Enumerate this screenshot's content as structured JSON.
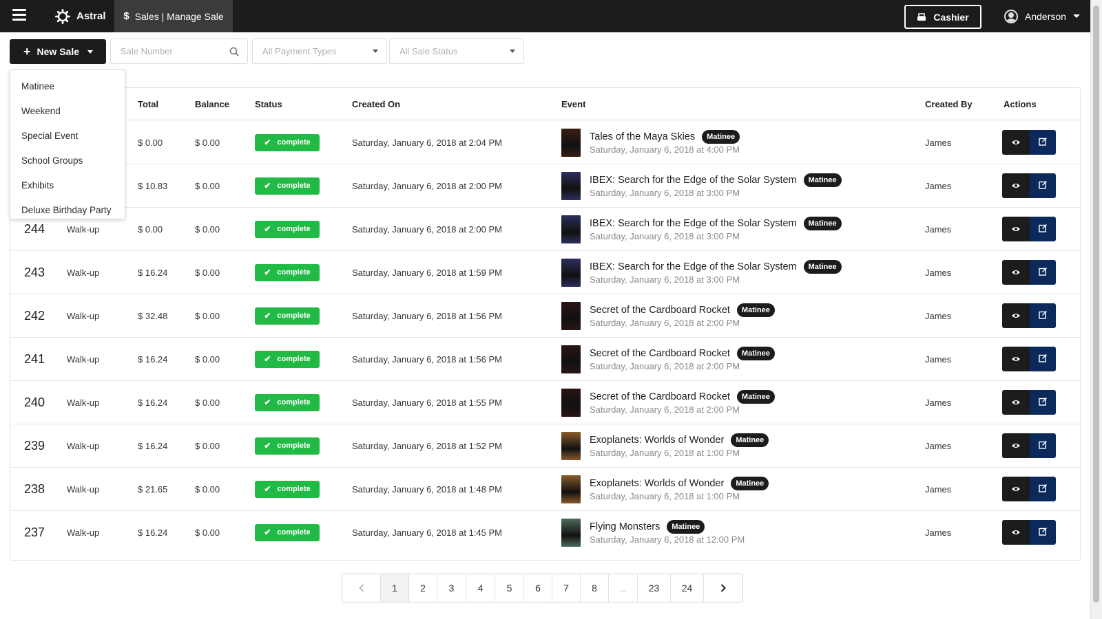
{
  "header": {
    "brand": "Astral",
    "nav_active": "Sales | Manage Sale",
    "cashier_label": "Cashier",
    "user_name": "Anderson"
  },
  "toolbar": {
    "new_sale_label": "New Sale",
    "search_placeholder": "Sale Number",
    "payment_types_label": "All Payment Types",
    "sale_status_label": "All Sale Status"
  },
  "new_sale_menu": [
    "Matinee",
    "Weekend",
    "Special Event",
    "School Groups",
    "Exhibits",
    "Deluxe Birthday Party"
  ],
  "table": {
    "headers": {
      "total": "Total",
      "balance": "Balance",
      "status": "Status",
      "created_on": "Created On",
      "event": "Event",
      "created_by": "Created By",
      "actions": "Actions"
    },
    "rows": [
      {
        "num": "",
        "type": "",
        "total": "$ 0.00",
        "balance": "$ 0.00",
        "status": "complete",
        "created_on": "Saturday, January 6, 2018 at 2:04 PM",
        "event_title": "Tales of the Maya Skies",
        "event_tag": "Matinee",
        "event_time": "Saturday, January 6, 2018 at 4:00 PM",
        "created_by": "James",
        "thumb_color": "#3a1e12"
      },
      {
        "num": "",
        "type": "",
        "total": "$ 10.83",
        "balance": "$ 0.00",
        "status": "complete",
        "created_on": "Saturday, January 6, 2018 at 2:00 PM",
        "event_title": "IBEX: Search for the Edge of the Solar System",
        "event_tag": "Matinee",
        "event_time": "Saturday, January 6, 2018 at 3:00 PM",
        "created_by": "James",
        "thumb_color": "#2c2f5e"
      },
      {
        "num": "244",
        "type": "Walk-up",
        "total": "$ 0.00",
        "balance": "$ 0.00",
        "status": "complete",
        "created_on": "Saturday, January 6, 2018 at 2:00 PM",
        "event_title": "IBEX: Search for the Edge of the Solar System",
        "event_tag": "Matinee",
        "event_time": "Saturday, January 6, 2018 at 3:00 PM",
        "created_by": "James",
        "thumb_color": "#2c2f5e"
      },
      {
        "num": "243",
        "type": "Walk-up",
        "total": "$ 16.24",
        "balance": "$ 0.00",
        "status": "complete",
        "created_on": "Saturday, January 6, 2018 at 1:59 PM",
        "event_title": "IBEX: Search for the Edge of the Solar System",
        "event_tag": "Matinee",
        "event_time": "Saturday, January 6, 2018 at 3:00 PM",
        "created_by": "James",
        "thumb_color": "#2c2f5e"
      },
      {
        "num": "242",
        "type": "Walk-up",
        "total": "$ 32.48",
        "balance": "$ 0.00",
        "status": "complete",
        "created_on": "Saturday, January 6, 2018 at 1:56 PM",
        "event_title": "Secret of the Cardboard Rocket",
        "event_tag": "Matinee",
        "event_time": "Saturday, January 6, 2018 at 2:00 PM",
        "created_by": "James",
        "thumb_color": "#2a1512"
      },
      {
        "num": "241",
        "type": "Walk-up",
        "total": "$ 16.24",
        "balance": "$ 0.00",
        "status": "complete",
        "created_on": "Saturday, January 6, 2018 at 1:56 PM",
        "event_title": "Secret of the Cardboard Rocket",
        "event_tag": "Matinee",
        "event_time": "Saturday, January 6, 2018 at 2:00 PM",
        "created_by": "James",
        "thumb_color": "#2a1512"
      },
      {
        "num": "240",
        "type": "Walk-up",
        "total": "$ 16.24",
        "balance": "$ 0.00",
        "status": "complete",
        "created_on": "Saturday, January 6, 2018 at 1:55 PM",
        "event_title": "Secret of the Cardboard Rocket",
        "event_tag": "Matinee",
        "event_time": "Saturday, January 6, 2018 at 2:00 PM",
        "created_by": "James",
        "thumb_color": "#2a1512"
      },
      {
        "num": "239",
        "type": "Walk-up",
        "total": "$ 16.24",
        "balance": "$ 0.00",
        "status": "complete",
        "created_on": "Saturday, January 6, 2018 at 1:52 PM",
        "event_title": "Exoplanets: Worlds of Wonder",
        "event_tag": "Matinee",
        "event_time": "Saturday, January 6, 2018 at 1:00 PM",
        "created_by": "James",
        "thumb_color": "#8a5a2b"
      },
      {
        "num": "238",
        "type": "Walk-up",
        "total": "$ 21.65",
        "balance": "$ 0.00",
        "status": "complete",
        "created_on": "Saturday, January 6, 2018 at 1:48 PM",
        "event_title": "Exoplanets: Worlds of Wonder",
        "event_tag": "Matinee",
        "event_time": "Saturday, January 6, 2018 at 1:00 PM",
        "created_by": "James",
        "thumb_color": "#8a5a2b"
      },
      {
        "num": "237",
        "type": "Walk-up",
        "total": "$ 16.24",
        "balance": "$ 0.00",
        "status": "complete",
        "created_on": "Saturday, January 6, 2018 at 1:45 PM",
        "event_title": "Flying Monsters",
        "event_tag": "Matinee",
        "event_time": "Saturday, January 6, 2018 at 12:00 PM",
        "created_by": "James",
        "thumb_color": "#4e6b5a"
      }
    ]
  },
  "pagination": {
    "pages": [
      "1",
      "2",
      "3",
      "4",
      "5",
      "6",
      "7",
      "8",
      "...",
      "23",
      "24"
    ],
    "current": "1"
  },
  "colors": {
    "topbar": "#1b1c1d",
    "complete": "#21ba45",
    "edit_button": "#0b2a5b"
  }
}
